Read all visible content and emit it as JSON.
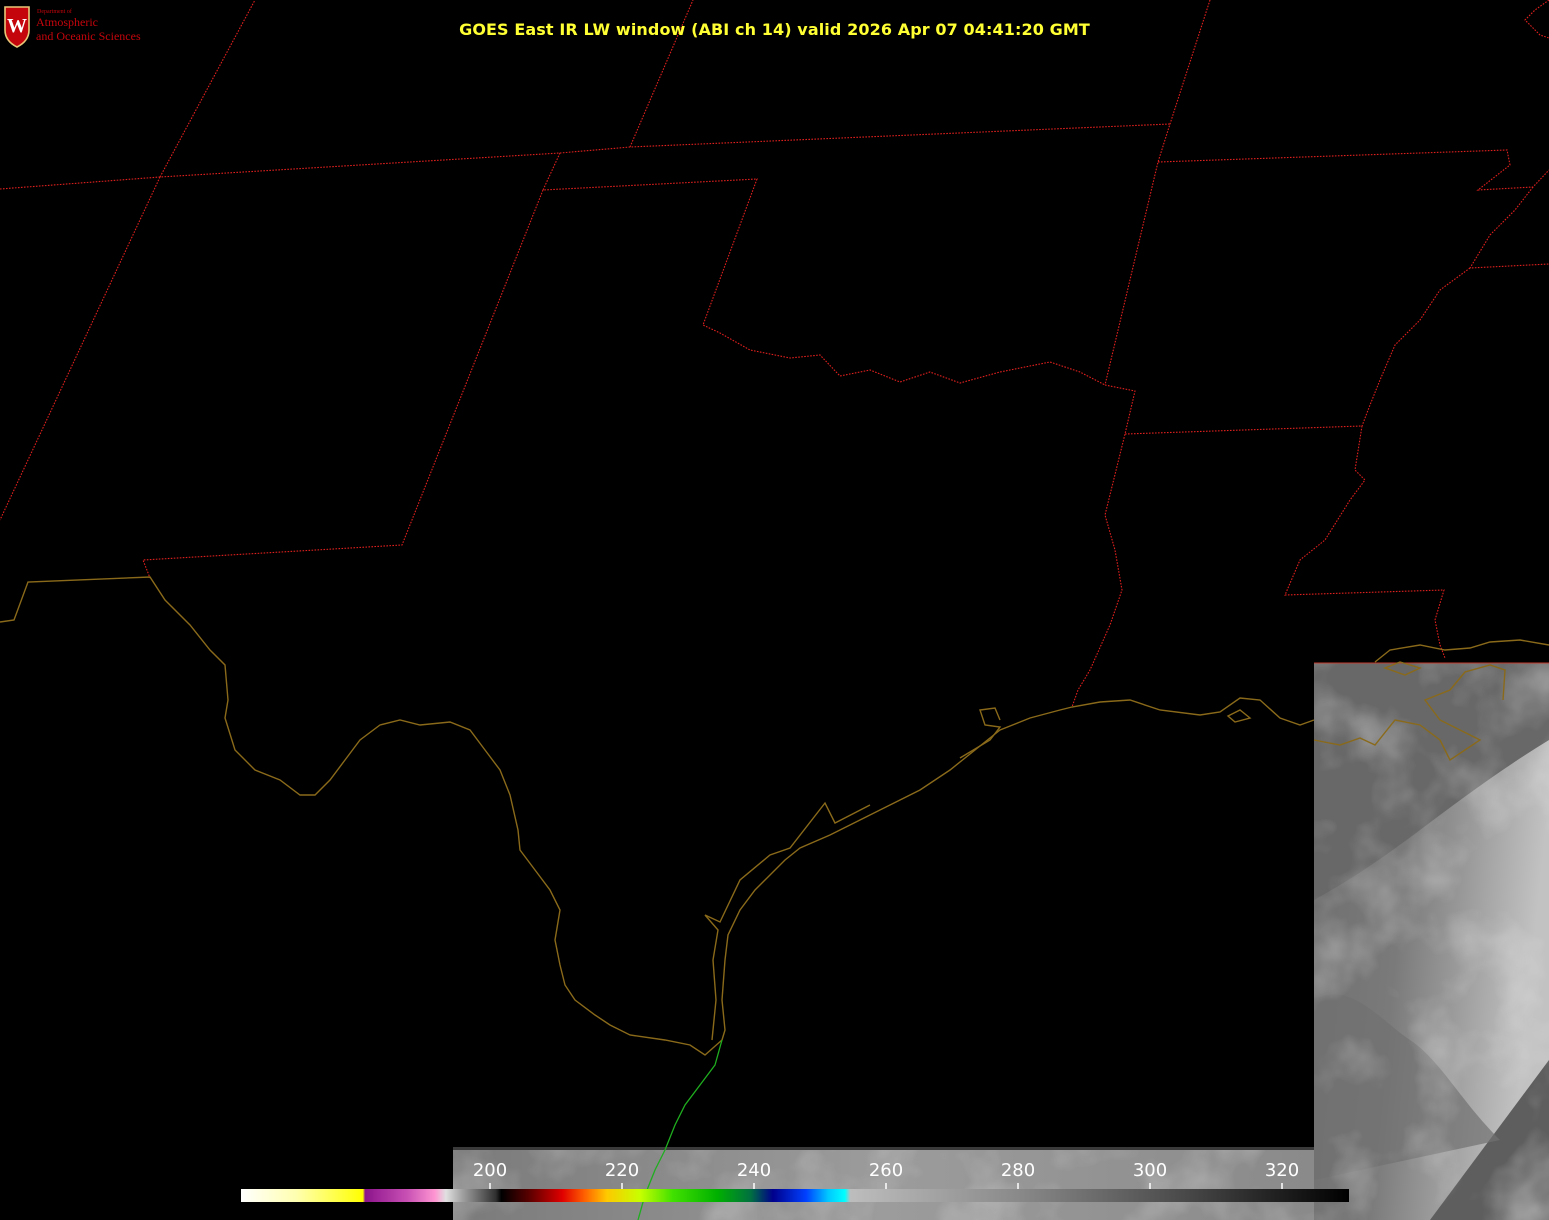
{
  "title": "GOES East IR LW window (ABI ch 14) valid 2026 Apr 07 04:41:20 GMT",
  "logo": {
    "dept_small": "Department of",
    "line1": "Atmospheric",
    "line2": "and Oceanic Sciences",
    "seal_letter": "W",
    "color": "#c5050c"
  },
  "colors": {
    "state_borders": "#e0201e",
    "coastline": "#8a6a1a",
    "border_line": "#1fae1f",
    "title": "#ffff33"
  },
  "colorbar": {
    "ticks": [
      "200",
      "220",
      "240",
      "260",
      "280",
      "300",
      "320"
    ]
  },
  "icons": [
    "uw-seal-icon"
  ]
}
